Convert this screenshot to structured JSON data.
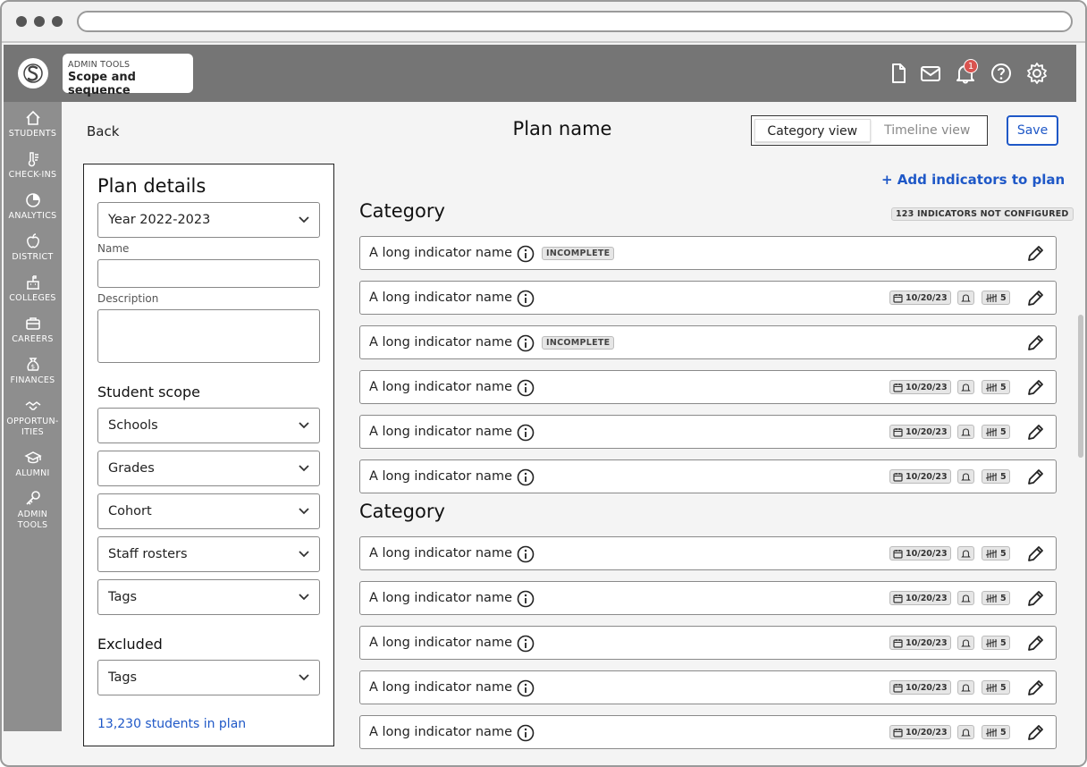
{
  "header": {
    "app_small": "ADMIN TOOLS",
    "app_title": "Scope and sequence",
    "notification_count": "1"
  },
  "nav": {
    "items": [
      {
        "label": "STUDENTS",
        "icon": "home-icon"
      },
      {
        "label": "CHECK-INS",
        "icon": "thermometer-icon"
      },
      {
        "label": "ANALYTICS",
        "icon": "pie-chart-icon"
      },
      {
        "label": "DISTRICT",
        "icon": "apple-icon"
      },
      {
        "label": "COLLEGES",
        "icon": "college-icon"
      },
      {
        "label": "CAREERS",
        "icon": "briefcase-icon"
      },
      {
        "label": "FINANCES",
        "icon": "money-bag-icon"
      },
      {
        "label": "OPPORTUN-",
        "label2": "ITIES",
        "icon": "handshake-icon"
      },
      {
        "label": "ALUMNI",
        "icon": "graduation-cap-icon"
      },
      {
        "label": "ADMIN",
        "label2": "TOOLS",
        "icon": "key-icon"
      }
    ]
  },
  "page": {
    "back": "Back",
    "title": "Plan name",
    "view_category": "Category view",
    "view_timeline": "Timeline view",
    "save": "Save"
  },
  "details": {
    "heading": "Plan details",
    "year": "Year 2022-2023",
    "name_label": "Name",
    "name_value": "",
    "description_label": "Description",
    "description_value": "",
    "scope_heading": "Student scope",
    "scope_selects": [
      "Schools",
      "Grades",
      "Cohort",
      "Staff rosters",
      "Tags"
    ],
    "excluded_heading": "Excluded",
    "excluded_select": "Tags",
    "student_count": "13,230 students in plan"
  },
  "indicators": {
    "add_link": "+ Add indicators to plan",
    "not_configured": "123 INDICATORS NOT CONFIGURED",
    "categories": [
      {
        "title": "Category",
        "rows": [
          {
            "name": "A long indicator name",
            "status": "INCOMPLETE"
          },
          {
            "name": "A long indicator name",
            "date": "10/20/23",
            "count": "5"
          },
          {
            "name": "A long indicator name",
            "status": "INCOMPLETE"
          },
          {
            "name": "A long indicator name",
            "date": "10/20/23",
            "count": "5"
          },
          {
            "name": "A long indicator name",
            "date": "10/20/23",
            "count": "5"
          },
          {
            "name": "A long indicator name",
            "date": "10/20/23",
            "count": "5"
          }
        ]
      },
      {
        "title": "Category",
        "rows": [
          {
            "name": "A long indicator name",
            "date": "10/20/23",
            "count": "5"
          },
          {
            "name": "A long indicator name",
            "date": "10/20/23",
            "count": "5"
          },
          {
            "name": "A long indicator name",
            "date": "10/20/23",
            "count": "5"
          },
          {
            "name": "A long indicator name",
            "date": "10/20/23",
            "count": "5"
          },
          {
            "name": "A long indicator name",
            "date": "10/20/23",
            "count": "5"
          }
        ]
      }
    ]
  }
}
